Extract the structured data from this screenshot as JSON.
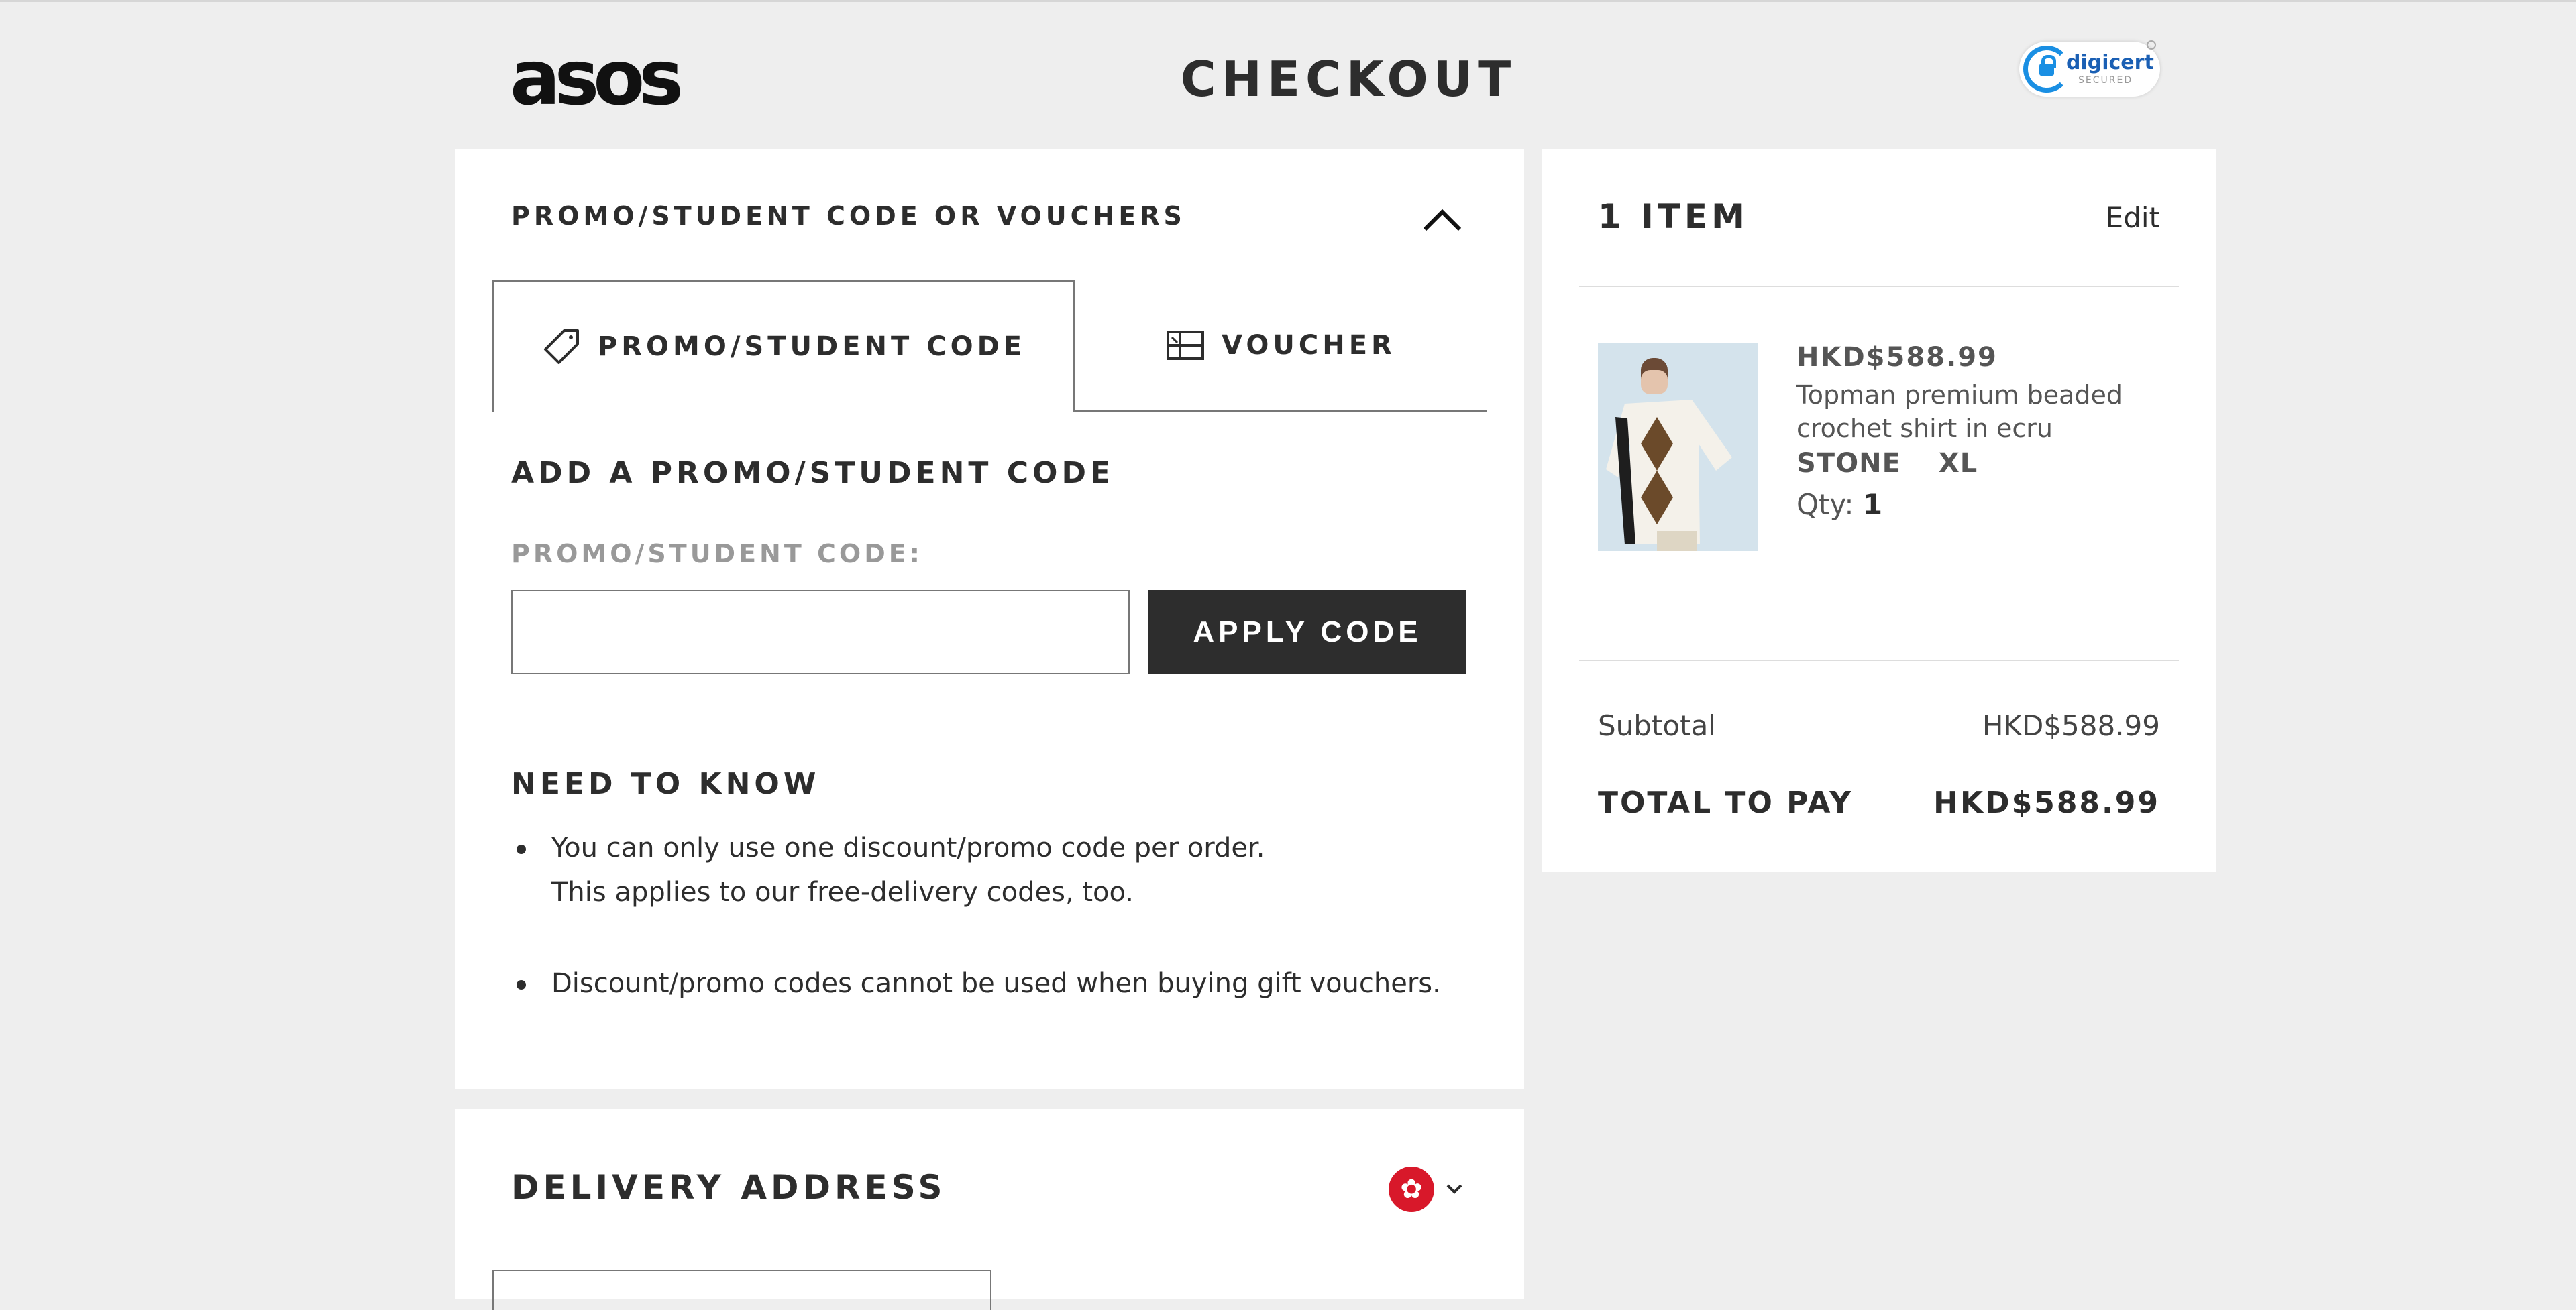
{
  "header": {
    "logo": "asos",
    "title": "CHECKOUT",
    "security_badge": {
      "brand": "digicert",
      "sub": "SECURED"
    }
  },
  "promo": {
    "heading": "PROMO/STUDENT CODE OR VOUCHERS",
    "tabs": [
      {
        "label": "PROMO/STUDENT CODE",
        "icon": "tag-icon",
        "active": true
      },
      {
        "label": "VOUCHER",
        "icon": "voucher-icon",
        "active": false
      }
    ],
    "add_heading": "ADD A PROMO/STUDENT CODE",
    "field_label": "PROMO/STUDENT CODE:",
    "input_value": "",
    "apply_label": "APPLY CODE",
    "need_heading": "NEED TO KNOW",
    "need_items": [
      {
        "line1": "You can only use one discount/promo code per order.",
        "line2": "This applies to our free-delivery codes, too."
      },
      {
        "line1": "Discount/promo codes cannot be used when buying gift vouchers.",
        "line2": ""
      }
    ]
  },
  "delivery": {
    "heading": "DELIVERY ADDRESS",
    "country_flag": "hong-kong-flag-icon"
  },
  "summary": {
    "items_heading": "1 ITEM",
    "edit_label": "Edit",
    "product": {
      "price": "HKD$588.99",
      "name": "Topman premium beaded crochet shirt in ecru",
      "colour": "STONE",
      "size": "XL",
      "qty_label": "Qty:",
      "qty_value": "1"
    },
    "subtotal_label": "Subtotal",
    "subtotal_value": "HKD$588.99",
    "total_label": "TOTAL TO PAY",
    "total_value": "HKD$588.99"
  },
  "colors": {
    "background": "#eeeeee",
    "panel": "#ffffff",
    "button": "#2d2d2d",
    "digicert_blue": "#1a8fe3",
    "flag_red": "#d8182a"
  }
}
